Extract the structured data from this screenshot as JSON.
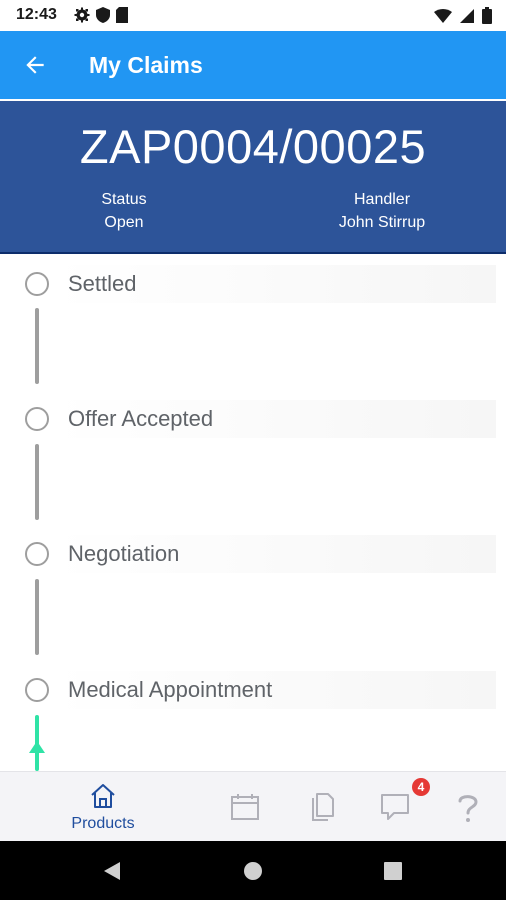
{
  "status_bar": {
    "time": "12:43",
    "left_icons": [
      "gear-icon",
      "shield-icon",
      "sd-card-icon"
    ],
    "right_icons": [
      "wifi-icon",
      "signal-icon",
      "battery-icon"
    ]
  },
  "app_bar": {
    "title": "My Claims",
    "back_icon": "arrow-left-icon",
    "background": "#2196f3"
  },
  "claim_header": {
    "claim_number": "ZAP0004/00025",
    "status_label": "Status",
    "status_value": "Open",
    "handler_label": "Handler",
    "handler_value": "John Stirrup",
    "background": "#2d5499"
  },
  "timeline": {
    "steps": [
      {
        "label": "Settled",
        "connector": "grey"
      },
      {
        "label": "Offer Accepted",
        "connector": "grey"
      },
      {
        "label": "Negotiation",
        "connector": "grey"
      },
      {
        "label": "Medical Appointment",
        "connector": "green-arrow"
      }
    ],
    "active_color": "#2fe3a6",
    "inactive_color": "#9e9e9e"
  },
  "bottom_nav": {
    "items": [
      {
        "icon": "home-icon",
        "label": "Products",
        "selected": true
      },
      {
        "icon": "calendar-icon",
        "label": ""
      },
      {
        "icon": "documents-icon",
        "label": ""
      },
      {
        "icon": "chat-icon",
        "label": "",
        "badge": "4"
      },
      {
        "icon": "help-icon",
        "label": ""
      }
    ],
    "accent": "#1f4d9e"
  },
  "system_nav": {
    "buttons": [
      "back-triangle-icon",
      "home-circle-icon",
      "recents-square-icon"
    ]
  }
}
